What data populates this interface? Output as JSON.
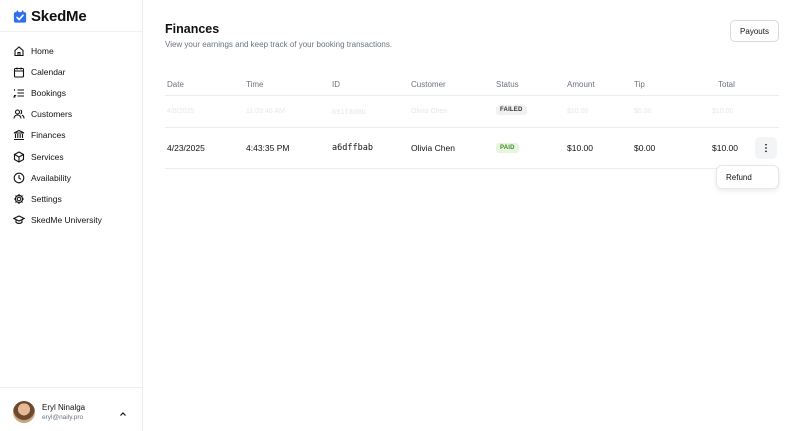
{
  "brand": {
    "name": "SkedMe",
    "accent": "#2f6fed"
  },
  "sidebar": {
    "items": [
      {
        "label": "Home",
        "icon": "home-icon"
      },
      {
        "label": "Calendar",
        "icon": "calendar-icon"
      },
      {
        "label": "Bookings",
        "icon": "list-icon"
      },
      {
        "label": "Customers",
        "icon": "users-icon"
      },
      {
        "label": "Finances",
        "icon": "bank-icon"
      },
      {
        "label": "Services",
        "icon": "box-icon"
      },
      {
        "label": "Availability",
        "icon": "clock-icon"
      },
      {
        "label": "Settings",
        "icon": "gear-icon"
      },
      {
        "label": "SkedMe University",
        "icon": "graduation-cap-icon"
      }
    ]
  },
  "user": {
    "name": "Eryl Ninalga",
    "email": "eryl@naily.pro"
  },
  "page": {
    "title": "Finances",
    "subtitle": "View your earnings and keep track of your booking transactions.",
    "payouts_label": "Payouts"
  },
  "table": {
    "headers": {
      "date": "Date",
      "time": "Time",
      "id": "ID",
      "customer": "Customer",
      "status": "Status",
      "amount": "Amount",
      "tip": "Tip",
      "total": "Total"
    },
    "rows": [
      {
        "date": "4/8/2025",
        "time": "11:09:46 AM",
        "id": "b91f8d0b",
        "customer": "Olivia Chen",
        "status": "FAILED",
        "amount": "$10.00",
        "tip": "$0.00",
        "total": "$10.00"
      },
      {
        "date": "4/23/2025",
        "time": "4:43:35 PM",
        "id": "a6dffbab",
        "customer": "Olivia Chen",
        "status": "PAID",
        "amount": "$10.00",
        "tip": "$0.00",
        "total": "$10.00"
      }
    ]
  },
  "menu": {
    "refund_label": "Refund"
  },
  "colors": {
    "paid_bg": "#e6f6de",
    "paid_text": "#3f8a2a",
    "failed_bg": "#f1f1f1"
  }
}
